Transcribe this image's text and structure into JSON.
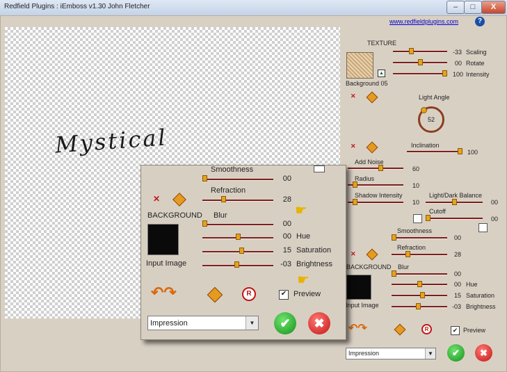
{
  "window": {
    "title": "Redfield  Plugins  :  iEmboss  v1.30   John Fletcher",
    "buttons": {
      "minimize": "–",
      "maximize": "□",
      "close": "X"
    }
  },
  "link": "www.redfieldplugins.com",
  "help": "?",
  "canvas_text": "Mystical",
  "texture": {
    "label": "TEXTURE",
    "name": "Background 05",
    "sliders": [
      {
        "label": "Scaling",
        "value": "-33",
        "level": 0.33
      },
      {
        "label": "Rotate",
        "value": "00",
        "level": 0.5
      },
      {
        "label": "Intensity",
        "value": "100",
        "level": 1.0
      }
    ]
  },
  "light": {
    "label": "Light  Angle",
    "angle": "52"
  },
  "inclination": {
    "label": "Inclination",
    "value": "100",
    "level": 1.0
  },
  "add_noise": {
    "label": "Add Noise",
    "value": "60",
    "level": 0.6
  },
  "radius": {
    "label": "Radius",
    "value": "10",
    "level": 0.1
  },
  "shadow_intensity": {
    "label": "Shadow Intensity",
    "value": "10",
    "level": 0.1
  },
  "light_dark_balance": {
    "label": "Light/Dark Balance",
    "value": "00",
    "level": 0.5
  },
  "cutoff": {
    "label": "Cutoff",
    "value": "00",
    "level": 0.0
  },
  "smoothness": {
    "label": "Smoothness",
    "value": "00",
    "level": 0.0
  },
  "refraction": {
    "label": "Refraction",
    "value": "28",
    "level": 0.28
  },
  "background": {
    "label": "BACKGROUND",
    "input_image": "Input Image",
    "sliders": [
      {
        "label": "Blur",
        "value": "00",
        "level": 0.0
      },
      {
        "label": "Hue",
        "value": "00",
        "level": 0.5
      },
      {
        "label": "Saturation",
        "value": "15",
        "level": 0.56
      },
      {
        "label": "Brightness",
        "value": "-03",
        "level": 0.48
      }
    ]
  },
  "preview": {
    "label": "Preview",
    "checked": "✔"
  },
  "preset": "Impression",
  "r_label": "R",
  "ok_symbol": "✔",
  "cancel_symbol": "✖"
}
